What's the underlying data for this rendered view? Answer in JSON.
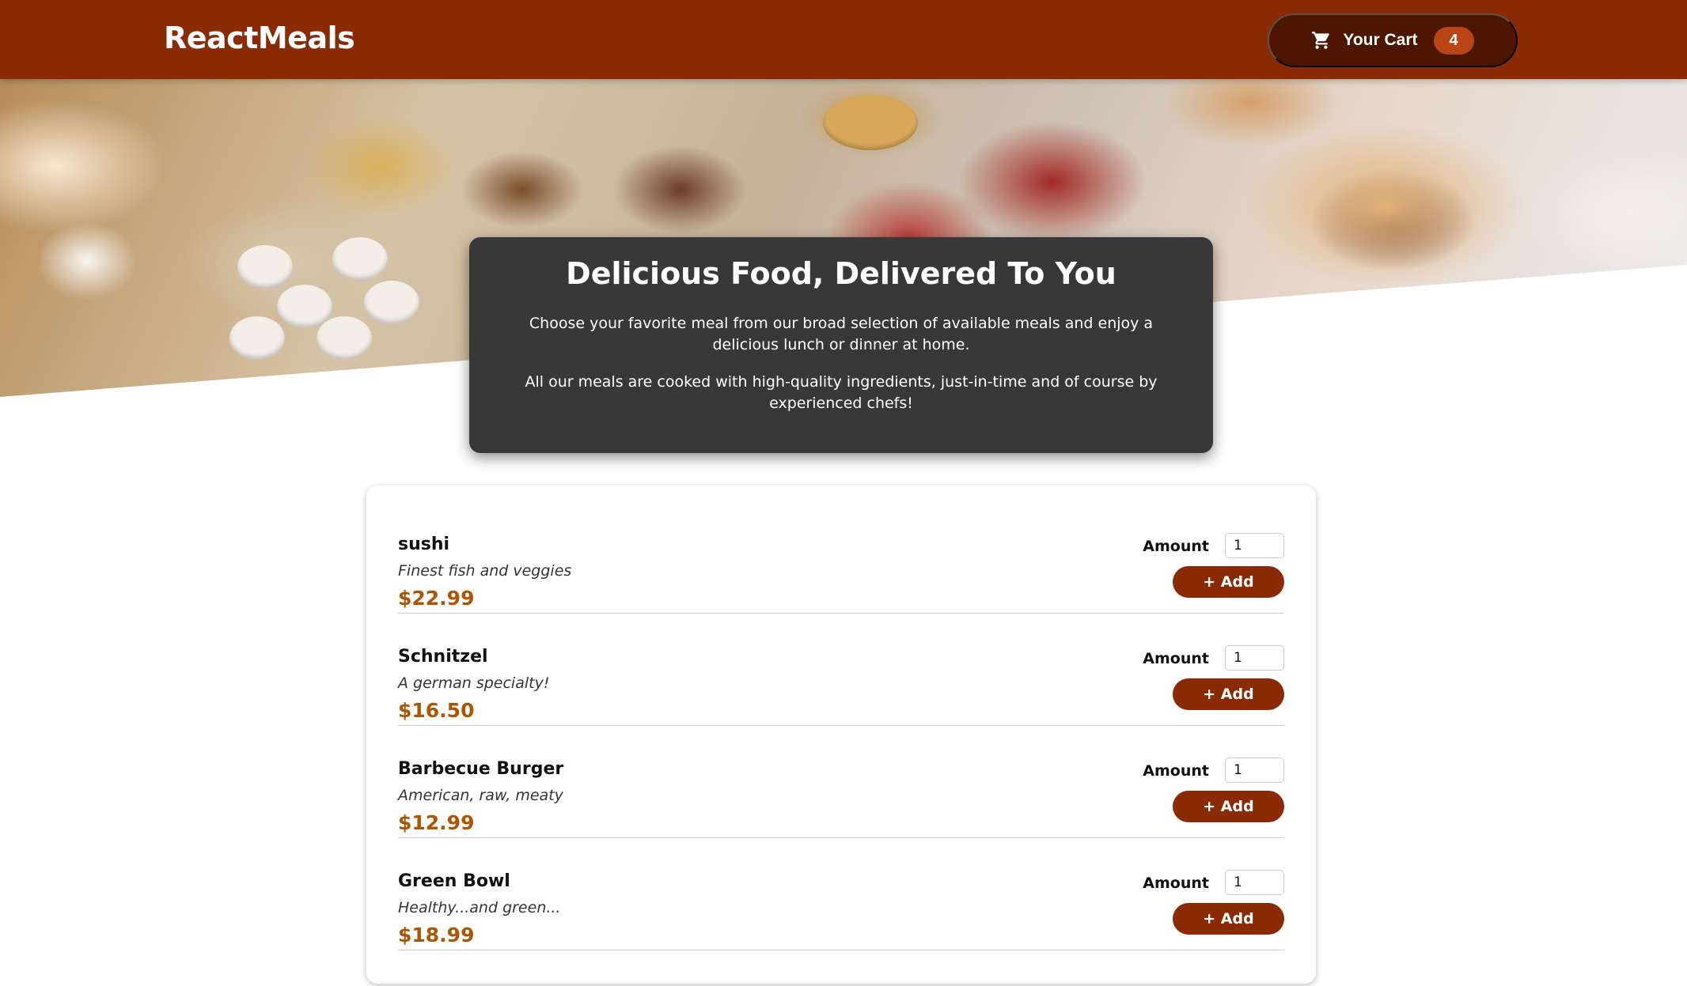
{
  "header": {
    "logo": "ReactMeals",
    "cart": {
      "icon": "cart-icon",
      "label": "Your Cart",
      "count": "4"
    }
  },
  "summary": {
    "title": "Delicious Food, Delivered To You",
    "paragraph1": "Choose your favorite meal from our broad selection of available meals and enjoy a delicious lunch or dinner at home.",
    "paragraph2": "All our meals are cooked with high-quality ingredients, just-in-time and of course by experienced chefs!"
  },
  "meals": {
    "amount_label": "Amount",
    "add_label": "+ Add",
    "items": [
      {
        "name": "sushi",
        "description": "Finest fish and veggies",
        "price": "$22.99",
        "amount": "1"
      },
      {
        "name": "Schnitzel",
        "description": "A german specialty!",
        "price": "$16.50",
        "amount": "1"
      },
      {
        "name": "Barbecue Burger",
        "description": "American, raw, meaty",
        "price": "$12.99",
        "amount": "1"
      },
      {
        "name": "Green Bowl",
        "description": "Healthy...and green...",
        "price": "$18.99",
        "amount": "1"
      }
    ]
  },
  "colors": {
    "header": "#8a2b06",
    "cart_button": "#4d1601",
    "badge": "#b94517",
    "summary_bg": "#383838",
    "price": "#ad5502"
  }
}
